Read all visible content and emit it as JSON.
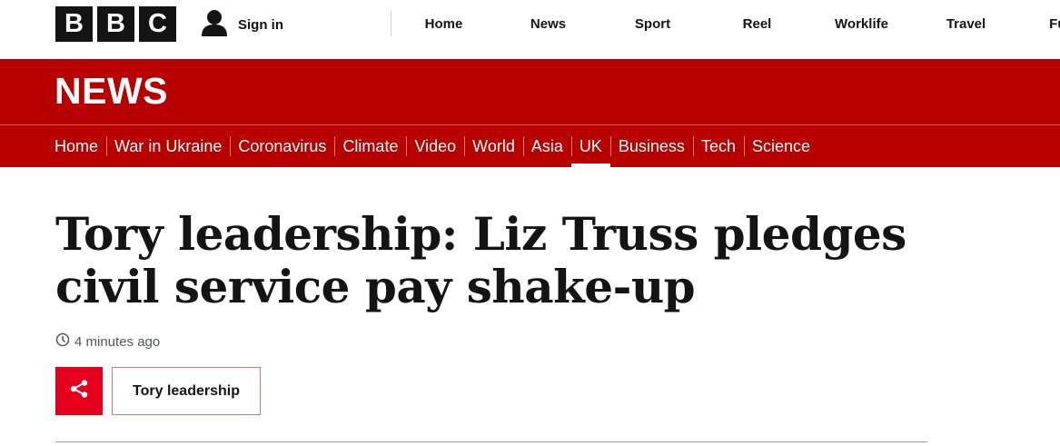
{
  "brand": {
    "letters": [
      "B",
      "B",
      "C"
    ]
  },
  "account": {
    "signin_label": "Sign in"
  },
  "top_nav": {
    "items": [
      {
        "label": "Home"
      },
      {
        "label": "News"
      },
      {
        "label": "Sport"
      },
      {
        "label": "Reel"
      },
      {
        "label": "Worklife"
      },
      {
        "label": "Travel"
      },
      {
        "label": "Future"
      }
    ]
  },
  "banner": {
    "title": "NEWS",
    "background_color": "#b80000"
  },
  "section_nav": {
    "items": [
      {
        "label": "Home"
      },
      {
        "label": "War in Ukraine"
      },
      {
        "label": "Coronavirus"
      },
      {
        "label": "Climate"
      },
      {
        "label": "Video"
      },
      {
        "label": "World"
      },
      {
        "label": "Asia"
      },
      {
        "label": "UK",
        "active": true
      },
      {
        "label": "Business"
      },
      {
        "label": "Tech"
      },
      {
        "label": "Science"
      }
    ]
  },
  "article": {
    "headline": "Tory leadership: Liz Truss pledges civil service pay shake-up",
    "timestamp": "4 minutes ago",
    "topic_tag": "Tory leadership",
    "share_icon": "share-icon",
    "share_color": "#e6001e"
  }
}
